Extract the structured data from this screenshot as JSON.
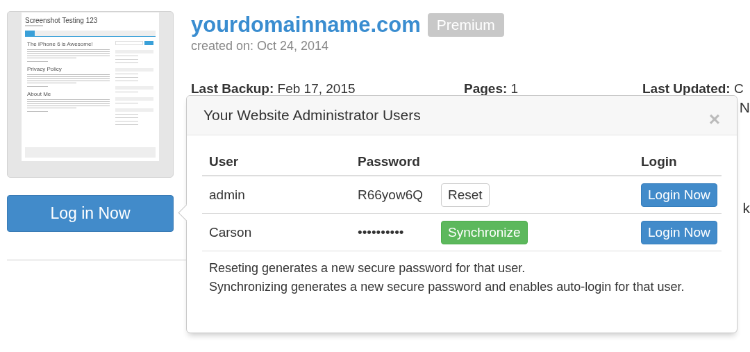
{
  "site": {
    "thumbnail": {
      "site_title": "Screenshot Testing 123",
      "posts": [
        "The iPhone 6 is Awesome!",
        "Privacy Policy",
        "About Me"
      ]
    },
    "login_button": "Log in Now",
    "domain": "yourdomainname.com",
    "plan": "Premium",
    "created": "created on: Oct 24, 2014",
    "stats": [
      "**Last Backup:** Feb 17, 2015",
      "**Pages:** 1",
      "**Last Updated:** C"
    ],
    "edge_fragments": [
      "N",
      "k"
    ]
  },
  "popover": {
    "title": "Your Website Administrator Users",
    "close": "×",
    "columns": [
      "User",
      "Password",
      "Login"
    ],
    "rows": [
      {
        "user": "admin",
        "password": "R66yow6Q",
        "action": {
          "kind": "reset",
          "label": "Reset"
        },
        "login": "Login Now"
      },
      {
        "user": "Carson",
        "password": "••••••••••",
        "action": {
          "kind": "sync",
          "label": "Synchronize"
        },
        "login": "Login Now"
      }
    ],
    "notes": [
      "Reseting generates a new secure password for that user.",
      "Synchronizing generates a new secure password and enables auto-login for that user."
    ]
  }
}
